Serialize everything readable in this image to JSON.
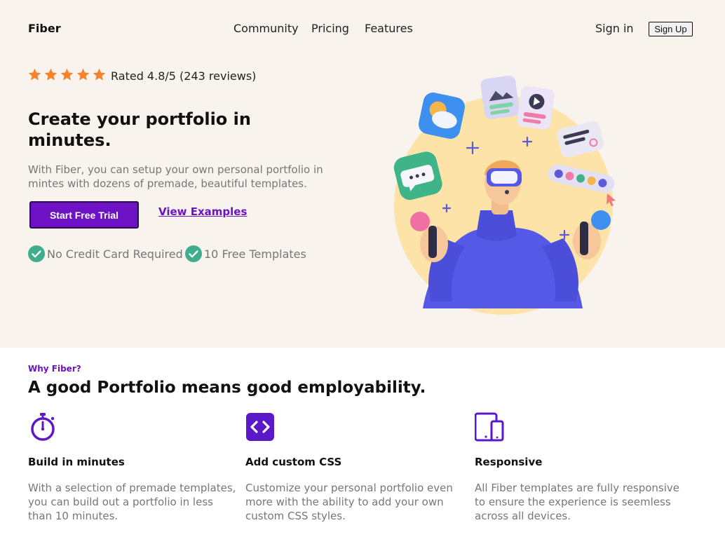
{
  "nav": {
    "logo": "Fiber",
    "links": [
      "Community",
      "Pricing",
      "Features"
    ],
    "signin": "Sign in",
    "signup": "Sign Up"
  },
  "hero": {
    "star_count": 5,
    "star_color": "#f5832a",
    "rating": "Rated 4.8/5 (243 reviews)",
    "headline": "Create your portfolio in minutes.",
    "subtext": "With Fiber, you can setup your own personal portfolio in mintes with dozens of premade, beautiful templates.",
    "cta_primary": "Start Free Trial",
    "cta_secondary": "View Examples",
    "checks": [
      "No Credit Card Required",
      "10 Free Templates"
    ],
    "check_color": "#3fae8f",
    "illustration_icon": "vr-avatar-juggling-app-icons-illustration"
  },
  "features": {
    "label": "Why Fiber?",
    "title": "A good Portfolio means good employability.",
    "accent_color": "#5b18c9",
    "items": [
      {
        "icon": "stopwatch-icon",
        "title": "Build in minutes",
        "desc": "With a selection of premade templates, you can build out a portfolio in less than 10 minutes."
      },
      {
        "icon": "code-icon",
        "title": "Add custom CSS",
        "desc": "Customize your personal portfolio even more with the ability to add your own custom CSS styles."
      },
      {
        "icon": "devices-icon",
        "title": "Responsive",
        "desc": "All Fiber templates are fully responsive to ensure the experience is seemless across all devices."
      }
    ]
  }
}
